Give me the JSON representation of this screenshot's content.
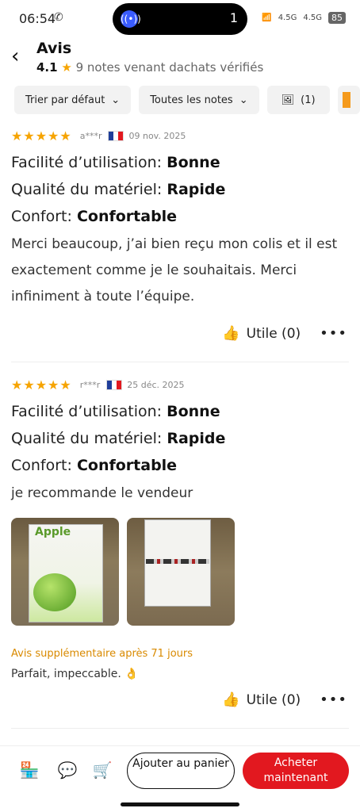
{
  "status": {
    "time": "06:54",
    "island_count": "1",
    "net1": "4.5G",
    "net2": "4.5G",
    "battery": "85"
  },
  "header": {
    "title": "Avis",
    "rating": "4.1",
    "rating_text": "9 notes venant dachats vérifiés"
  },
  "filters": {
    "sort": "Trier par défaut",
    "notes": "Toutes les notes",
    "photos": "(1)"
  },
  "reviews": [
    {
      "stars": "★★★★★",
      "reviewer": "a***r",
      "date": "09 nov. 2025",
      "attrs": [
        {
          "label": "Facilité d’utilisation: ",
          "value": "Bonne"
        },
        {
          "label": "Qualité du matériel: ",
          "value": "Rapide"
        },
        {
          "label": "Confort: ",
          "value": "Confortable"
        }
      ],
      "text": "Merci beaucoup, j’ai bien reçu mon colis et il est exactement comme je le souhaitais. Merci infiniment à toute l’équipe.",
      "useful": "Utile (0)"
    },
    {
      "stars": "★★★★★",
      "reviewer": "r***r",
      "date": "25 déc. 2025",
      "attrs": [
        {
          "label": "Facilité d’utilisation: ",
          "value": "Bonne"
        },
        {
          "label": "Qualité du matériel: ",
          "value": "Rapide"
        },
        {
          "label": "Confort: ",
          "value": "Confortable"
        }
      ],
      "text": "je recommande le vendeur",
      "photo_brand": "Apple",
      "extra_label": "Avis supplémentaire après 71 jours",
      "extra_text": "Parfait, impeccable. 👌",
      "useful": "Utile (0)"
    }
  ],
  "bottom": {
    "add_to_cart": "Ajouter au panier",
    "buy_now": "Acheter maintenant"
  },
  "colors": {
    "accent": "#e2181f",
    "star": "#f6a400",
    "extra": "#d98a00"
  }
}
